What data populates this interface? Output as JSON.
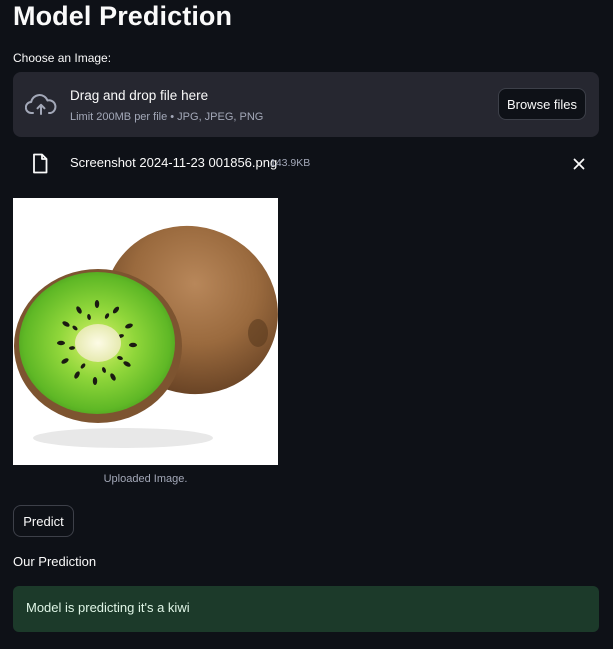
{
  "page": {
    "title": "Model Prediction"
  },
  "uploader": {
    "label": "Choose an Image:",
    "drop_title": "Drag and drop file here",
    "drop_subtitle": "Limit 200MB per file • JPG, JPEG, PNG",
    "browse_label": "Browse files",
    "upload_icon": "cloud-upload-icon"
  },
  "file": {
    "name": "Screenshot 2024-11-23 001856.png",
    "size": "143.9KB",
    "file_icon": "file-icon",
    "remove_icon": "close-icon"
  },
  "image": {
    "caption": "Uploaded Image."
  },
  "actions": {
    "predict_label": "Predict"
  },
  "result": {
    "subheader": "Our Prediction",
    "message": "Model is predicting it's a kiwi",
    "color": "#1c3a2a"
  },
  "colors": {
    "background": "#0e1117",
    "panel": "#262730",
    "text": "#fafafa",
    "muted": "#a3a8b8"
  }
}
